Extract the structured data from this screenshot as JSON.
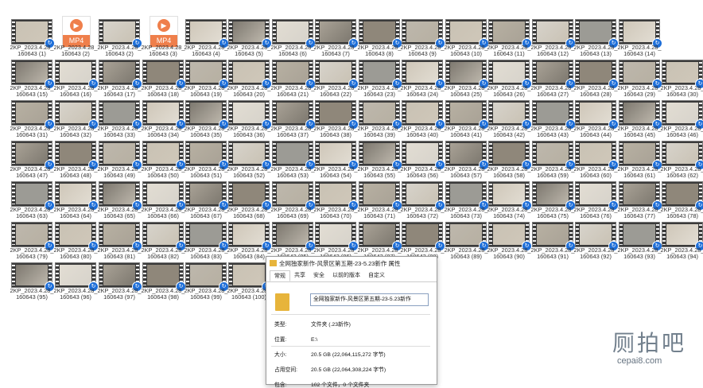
{
  "files": {
    "mp4_badge": "MP4",
    "play_glyph": "▶",
    "sync_glyph": "↻",
    "items": [
      "2KP_2023.4.28_\n160643 (1)",
      "2KP_2023.4.28_\n160643 (2)",
      "2KP_2023.4.28_\n160643 (2)",
      "2KP_2023.4.28_\n160643 (3)",
      "2KP_2023.4.28_\n160643 (4)",
      "2KP_2023.4.28_\n160643 (5)",
      "2KP_2023.4.28_\n160643 (6)",
      "2KP_2023.4.28_\n160643 (7)",
      "2KP_2023.4.28_\n160643 (8)",
      "2KP_2023.4.28_\n160643 (9)",
      "2KP_2023.4.28_\n160643 (10)",
      "2KP_2023.4.28_\n160643 (11)",
      "2KP_2023.4.28_\n160643 (12)",
      "2KP_2023.4.28_\n160643 (13)",
      "2KP_2023.4.28_\n160643 (14)",
      "2KP_2023.4.28_\n160643 (15)",
      "2KP_2023.4.28_\n160643 (16)",
      "2KP_2023.4.28_\n160643 (17)",
      "2KP_2023.4.28_\n160643 (18)",
      "2KP_2023.4.28_\n160643 (19)",
      "2KP_2023.4.28_\n160643 (20)",
      "2KP_2023.4.28_\n160643 (21)",
      "2KP_2023.4.28_\n160643 (22)",
      "2KP_2023.4.28_\n160643 (23)",
      "2KP_2023.4.28_\n160643 (24)",
      "2KP_2023.4.28_\n160643 (25)",
      "2KP_2023.4.28_\n160643 (26)",
      "2KP_2023.4.28_\n160643 (27)",
      "2KP_2023.4.28_\n160643 (28)",
      "2KP_2023.4.28_\n160643 (29)",
      "2KP_2023.4.28_\n160643 (30)",
      "2KP_2023.4.28_\n160643 (31)",
      "2KP_2023.4.28_\n160643 (32)",
      "2KP_2023.4.28_\n160643 (33)",
      "2KP_2023.4.28_\n160643 (34)",
      "2KP_2023.4.28_\n160643 (35)",
      "2KP_2023.4.28_\n160643 (36)",
      "2KP_2023.4.28_\n160643 (37)",
      "2KP_2023.4.28_\n160643 (38)",
      "2KP_2023.4.28_\n160643 (39)",
      "2KP_2023.4.28_\n160643 (40)",
      "2KP_2023.4.28_\n160643 (41)",
      "2KP_2023.4.28_\n160643 (42)",
      "2KP_2023.4.28_\n160643 (43)",
      "2KP_2023.4.28_\n160643 (44)",
      "2KP_2023.4.28_\n160643 (45)",
      "2KP_2023.4.28_\n160643 (46)",
      "2KP_2023.4.28_\n160643 (47)",
      "2KP_2023.4.28_\n160643 (48)",
      "2KP_2023.4.28_\n160643 (49)",
      "2KP_2023.4.28_\n160643 (50)",
      "2KP_2023.4.28_\n160643 (51)",
      "2KP_2023.4.28_\n160643 (52)",
      "2KP_2023.4.28_\n160643 (53)",
      "2KP_2023.4.28_\n160643 (54)",
      "2KP_2023.4.28_\n160643 (55)",
      "2KP_2023.4.28_\n160643 (56)",
      "2KP_2023.4.28_\n160643 (57)",
      "2KP_2023.4.28_\n160643 (58)",
      "2KP_2023.4.28_\n160643 (59)",
      "2KP_2023.4.28_\n160643 (60)",
      "2KP_2023.4.28_\n160643 (61)",
      "2KP_2023.4.28_\n160643 (62)",
      "2KP_2023.4.28_\n160643 (63)",
      "2KP_2023.4.28_\n160643 (64)",
      "2KP_2023.4.28_\n160643 (65)",
      "2KP_2023.4.28_\n160643 (66)",
      "2KP_2023.4.28_\n160643 (67)",
      "2KP_2023.4.28_\n160643 (68)",
      "2KP_2023.4.28_\n160643 (69)",
      "2KP_2023.4.28_\n160643 (70)",
      "2KP_2023.4.28_\n160643 (71)",
      "2KP_2023.4.28_\n160643 (72)",
      "2KP_2023.4.28_\n160643 (73)",
      "2KP_2023.4.28_\n160643 (74)",
      "2KP_2023.4.28_\n160643 (75)",
      "2KP_2023.4.28_\n160643 (76)",
      "2KP_2023.4.28_\n160643 (77)",
      "2KP_2023.4.28_\n160643 (78)",
      "2KP_2023.4.28_\n160643 (79)",
      "2KP_2023.4.28_\n160643 (80)",
      "2KP_2023.4.28_\n160643 (81)",
      "2KP_2023.4.28_\n160643 (82)",
      "2KP_2023.4.28_\n160643 (83)",
      "2KP_2023.4.28_\n160643 (84)",
      "2KP_2023.4.28_\n160643 (85)",
      "2KP_2023.4.28_\n160643 (86)",
      "2KP_2023.4.28_\n160643 (87)",
      "2KP_2023.4.28_\n160643 (88)",
      "2KP_2023.4.28_\n160643 (89)",
      "2KP_2023.4.28_\n160643 (90)",
      "2KP_2023.4.28_\n160643 (91)",
      "2KP_2023.4.28_\n160643 (92)",
      "2KP_2023.4.28_\n160643 (93)",
      "2KP_2023.4.28_\n160643 (94)",
      "2KP_2023.4.28_\n160643 (95)",
      "2KP_2023.4.28_\n160643 (96)",
      "2KP_2023.4.28_\n160643 (97)",
      "2KP_2023.4.28_\n160643 (98)",
      "2KP_2023.4.28_\n160643 (99)",
      "2KP_2023.4.28_\n160643 (100)"
    ],
    "mp4_positions": [
      1,
      3
    ]
  },
  "dialog": {
    "title": "全网独家新作-风景区第五期-23-5.23新作 属性",
    "tabs": [
      "常规",
      "共享",
      "安全",
      "以前的版本",
      "自定义"
    ],
    "active_tab": "常规",
    "folder_name": "全网独家新作-风景区第五期-23-5.23新作",
    "rows": [
      {
        "k": "类型:",
        "v": "文件夹 (.23新作)"
      },
      {
        "k": "位置:",
        "v": "E:\\"
      },
      {
        "k": "大小:",
        "v": "20.5 GB (22,064,115,272 字节)"
      },
      {
        "k": "占用空间:",
        "v": "20.5 GB (22,064,308,224 字节)"
      },
      {
        "k": "包含:",
        "v": "102 个文件，0 个文件夹"
      }
    ]
  },
  "watermark": {
    "cn": "厕拍吧",
    "en": "cepai8.com"
  },
  "colors": {
    "badge": "#1e6fd9",
    "mp4": "#ef7f4b",
    "folder": "#e7b43b"
  }
}
